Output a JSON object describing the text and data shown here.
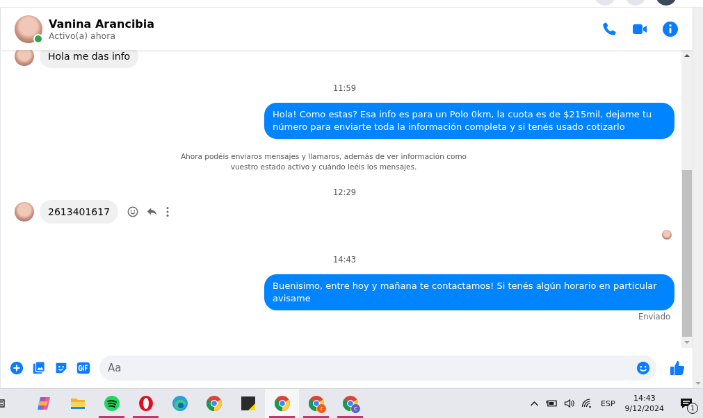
{
  "header": {
    "name": "Vanina Arancibia",
    "status": "Activo(a) ahora",
    "online": true
  },
  "messages": [
    {
      "kind": "incoming",
      "text": "Hola me das info",
      "actions": false
    },
    {
      "kind": "time",
      "text": "11:59"
    },
    {
      "kind": "outgoing",
      "text": "Hola! Como estas? Esa info es para un Polo 0km, la cuota es de $215mil, dejame tu número para enviarte toda la información completa y si tenés usado cotizarlo"
    },
    {
      "kind": "notice",
      "text": "Ahora podéis enviaros mensajes y llamaros, además de ver información como vuestro estado activo y cuándo leéis los mensajes."
    },
    {
      "kind": "time",
      "text": "12:29"
    },
    {
      "kind": "incoming",
      "text": "2613401617",
      "actions": true
    },
    {
      "kind": "seen"
    },
    {
      "kind": "time",
      "text": "14:43"
    },
    {
      "kind": "outgoing",
      "text": "Buenisimo, entre hoy y mañana te contactamos! Si tenés algún horario en particular avisame"
    },
    {
      "kind": "status",
      "text": "Enviado"
    }
  ],
  "composer": {
    "placeholder": "Aa"
  },
  "taskbar": {
    "apps": [
      {
        "kind": "copilot",
        "running": false,
        "selected": false
      },
      {
        "kind": "folder",
        "running": false,
        "selected": false
      },
      {
        "kind": "spotify",
        "running": true,
        "selected": false
      },
      {
        "kind": "opera",
        "running": true,
        "selected": false
      },
      {
        "kind": "edge",
        "running": false,
        "selected": false
      },
      {
        "kind": "chrome",
        "running": false,
        "selected": false
      },
      {
        "kind": "sticky",
        "running": false,
        "selected": false
      },
      {
        "kind": "chrome",
        "running": true,
        "selected": true
      },
      {
        "kind": "chrome",
        "running": true,
        "selected": false,
        "badge": "r",
        "color": "#f25a1e"
      },
      {
        "kind": "chrome",
        "running": true,
        "selected": false,
        "badge": "c",
        "color": "#5b5fc7"
      }
    ],
    "language": "ESP",
    "time": "14:43",
    "date": "9/12/2024",
    "notifications": "1"
  }
}
